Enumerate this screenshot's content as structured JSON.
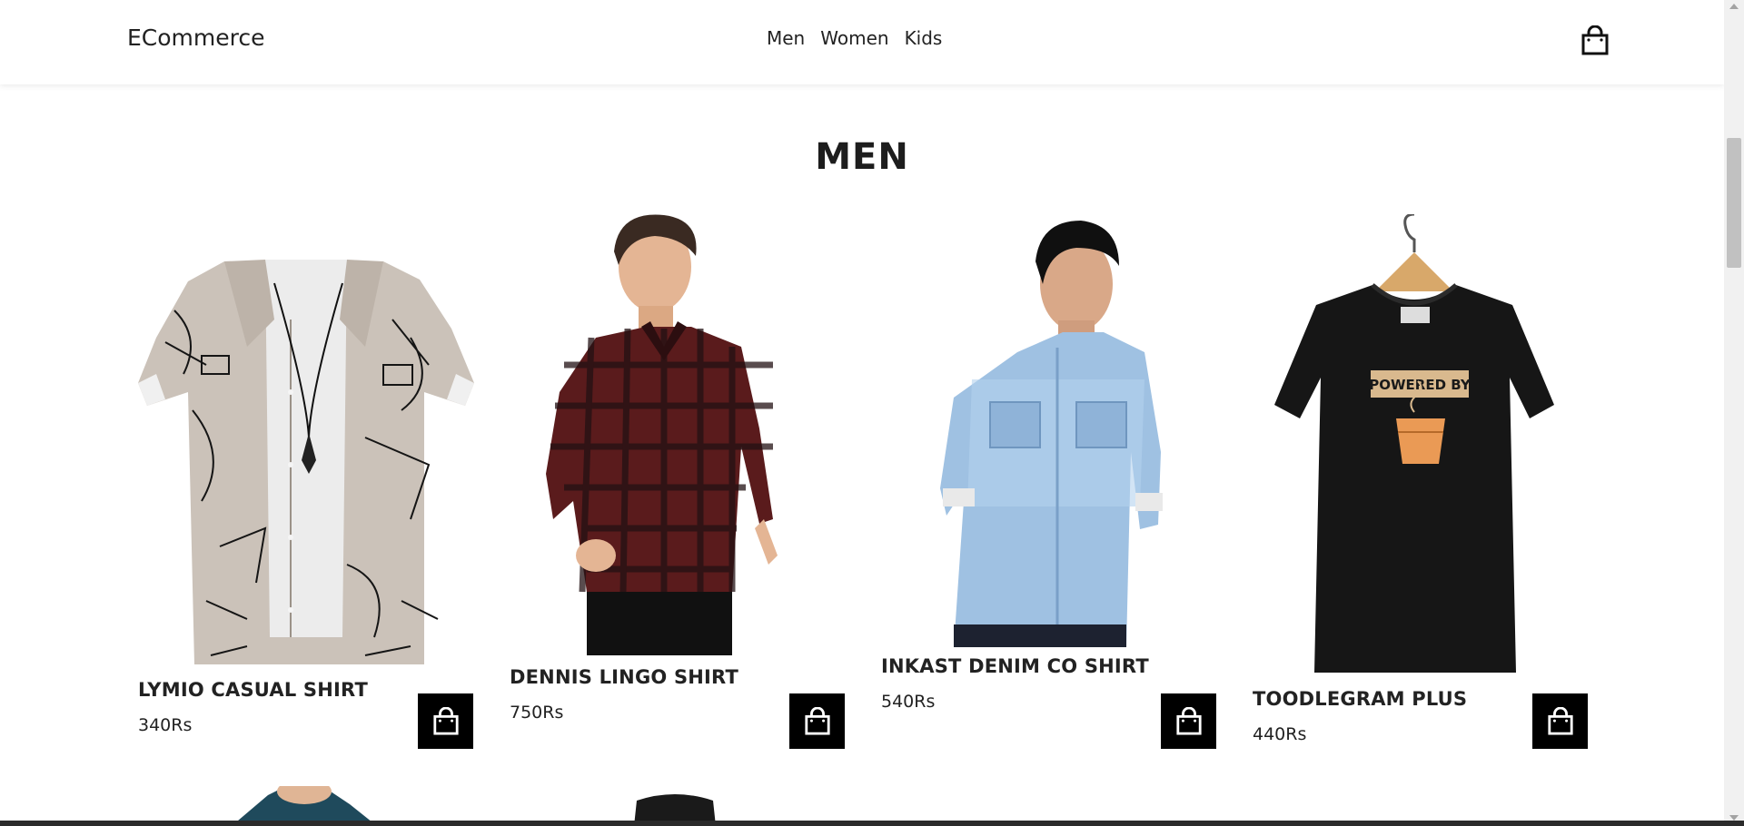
{
  "header": {
    "logo": "ECommerce",
    "nav": [
      "Men",
      "Women",
      "Kids"
    ],
    "cart_icon": "shopping-bag-icon"
  },
  "section": {
    "title": "MEN"
  },
  "products": [
    {
      "name": "LYMIO CASUAL SHIRT",
      "price": "340Rs",
      "image": "printed-short-sleeve-shirt"
    },
    {
      "name": "DENNIS LINGO SHIRT",
      "price": "750Rs",
      "image": "man-in-red-check-shirt"
    },
    {
      "name": "INKAST DENIM CO SHIRT",
      "price": "540Rs",
      "image": "man-in-blue-denim-shirt"
    },
    {
      "name": "TOODLEGRAM PLUS",
      "price": "440Rs",
      "image": "black-tshirt-on-hanger",
      "print_text": "POWERED BY"
    }
  ],
  "colors": {
    "accent": "#000000",
    "background": "#ffffff",
    "text": "#222222"
  }
}
